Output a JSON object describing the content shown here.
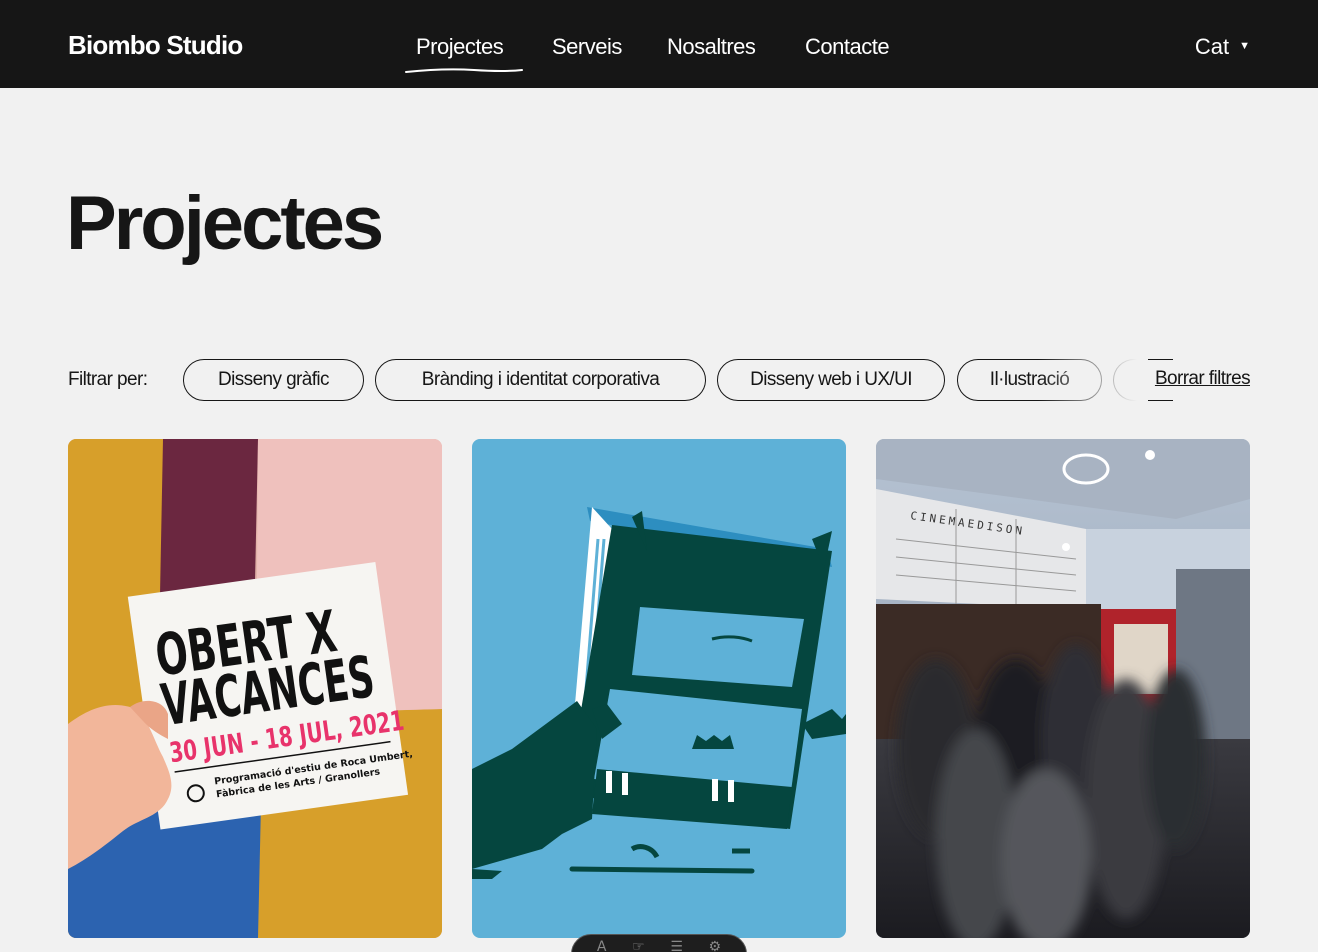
{
  "brand": {
    "name": "Biombo Studio"
  },
  "nav": {
    "items": [
      {
        "label": "Projectes",
        "active": true
      },
      {
        "label": "Serveis"
      },
      {
        "label": "Nosaltres"
      },
      {
        "label": "Contacte"
      }
    ],
    "language": "Cat"
  },
  "page": {
    "title": "Projectes"
  },
  "filters": {
    "label": "Filtrar per:",
    "chips": [
      "Disseny gràfic",
      "Brànding i identitat corporativa",
      "Disseny web i UX/UI",
      "Il·lustració"
    ],
    "clear_label": "Borrar filtres"
  },
  "projects": {
    "p1": {
      "line1": "OBERT X",
      "line2": "VACANCES",
      "dates": "30 JUN - 18 JUL, 2021",
      "sub1": "Programació d'estiu de Roca Umbert,",
      "sub2": "Fàbrica de les Arts / Granollers"
    },
    "p2": {},
    "p3": {
      "sign": "CINEMAEDISON"
    }
  },
  "colors": {
    "header_bg": "#161616",
    "page_bg": "#f1f1f1",
    "accent_pink": "#e8336b",
    "card2_bg": "#5eb1d7",
    "card2_hero": "#05463f"
  },
  "icons": {
    "language_caret": "caret-down-icon",
    "dock": [
      "text-icon",
      "cursor-icon",
      "menu-icon",
      "gear-icon"
    ]
  }
}
